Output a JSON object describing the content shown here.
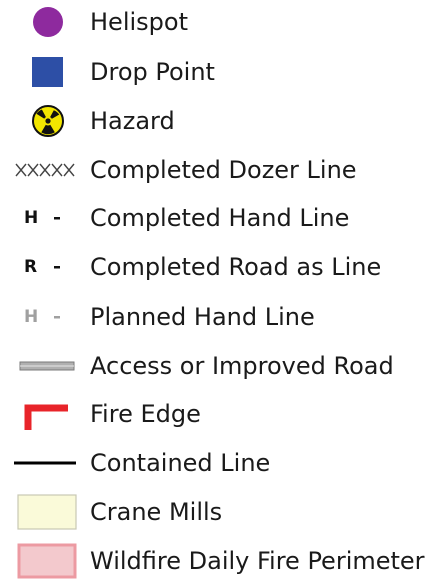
{
  "legend": {
    "items": [
      {
        "label": "Helispot",
        "icon": "purple-circle-icon",
        "color": "#8e2a9e"
      },
      {
        "label": "Drop Point",
        "icon": "blue-square-icon",
        "color": "#2d4fa6"
      },
      {
        "label": "Hazard",
        "icon": "radiation-hazard-icon",
        "color": "#f2e600"
      },
      {
        "label": "Completed Dozer Line",
        "icon": "dozer-line-icon",
        "color": "#444444"
      },
      {
        "label": "Completed Hand Line",
        "icon": "hand-line-icon",
        "symbol_text": "H",
        "color": "#111111"
      },
      {
        "label": "Completed Road as Line",
        "icon": "road-line-icon",
        "symbol_text": "R",
        "color": "#111111"
      },
      {
        "label": "Planned Hand Line",
        "icon": "planned-hand-line-icon",
        "symbol_text": "H",
        "color": "#a0a0a0"
      },
      {
        "label": "Access or Improved Road",
        "icon": "road-icon",
        "color": "#b0b0b0"
      },
      {
        "label": "Fire Edge",
        "icon": "fire-edge-icon",
        "color": "#e8242a"
      },
      {
        "label": "Contained Line",
        "icon": "contained-line-icon",
        "color": "#000000"
      },
      {
        "label": "Crane Mills",
        "icon": "crane-mills-swatch-icon",
        "color": "#fafad9"
      },
      {
        "label": "Wildfire Daily Fire Perimeter",
        "icon": "fire-perimeter-swatch-icon",
        "color": "#f3c9cd"
      }
    ]
  }
}
